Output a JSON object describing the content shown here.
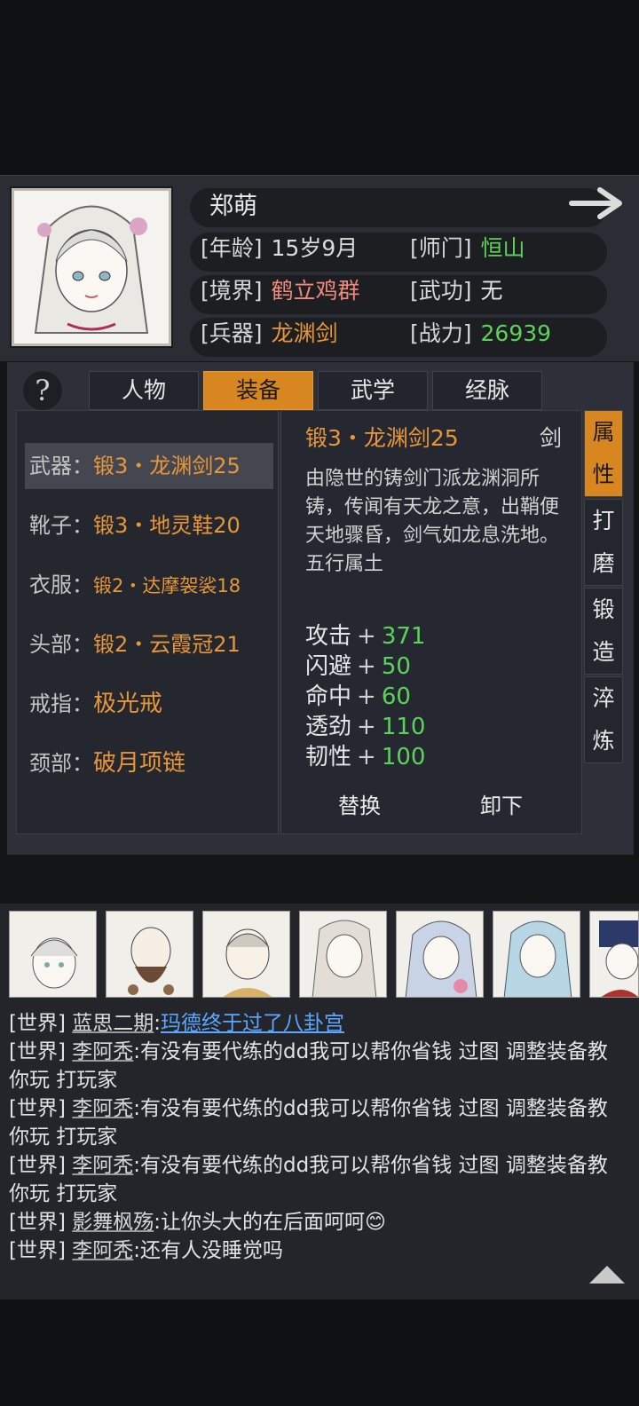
{
  "character": {
    "name": "郑萌",
    "stats": [
      {
        "key": "[年龄]",
        "value": "15岁9月",
        "color": "#dcdcdc"
      },
      {
        "key": "[师门]",
        "value": "恒山",
        "color": "#5bd35b"
      },
      {
        "key": "[境界]",
        "value": "鹤立鸡群",
        "color": "#f08a7a"
      },
      {
        "key": "[武功]",
        "value": "无",
        "color": "#e2e2e2"
      },
      {
        "key": "[兵器]",
        "value": "龙渊剑",
        "color": "#e8963a"
      },
      {
        "key": "[战力]",
        "value": "26939",
        "color": "#5bd35b"
      }
    ]
  },
  "tabs": [
    "人物",
    "装备",
    "武学",
    "经脉"
  ],
  "active_tab": "装备",
  "equipment_slots": [
    {
      "slot": "武器：",
      "item": "锻3・龙渊剑25"
    },
    {
      "slot": "靴子：",
      "item": "锻3・地灵鞋20"
    },
    {
      "slot": "衣服：",
      "item": "锻2・达摩袈裟18"
    },
    {
      "slot": "头部：",
      "item": "锻2・云霞冠21"
    },
    {
      "slot": "戒指：",
      "item": "极光戒"
    },
    {
      "slot": "颈部：",
      "item": "破月项链"
    }
  ],
  "detail": {
    "title": "锻3・龙渊剑25",
    "type": "剑",
    "description": "由隐世的铸剑门派龙渊洞所铸，传闻有天龙之意，出鞘便天地骤昏，剑气如龙息洗地。",
    "element": "五行属土",
    "attributes": [
      {
        "name": "攻击",
        "value": "371"
      },
      {
        "name": "闪避",
        "value": "50"
      },
      {
        "name": "命中",
        "value": "60"
      },
      {
        "name": "透劲",
        "value": "110"
      },
      {
        "name": "韧性",
        "value": "100"
      }
    ],
    "buttons": {
      "replace": "替换",
      "unequip": "卸下"
    }
  },
  "side_tabs": [
    {
      "label": "属性",
      "active": true
    },
    {
      "label": "打磨",
      "active": false
    },
    {
      "label": "锻造",
      "active": false
    },
    {
      "label": "淬炼",
      "active": false
    }
  ],
  "chat": [
    {
      "channel": "[世界]",
      "user": "蓝思二期",
      "text": ":",
      "link": "玛德终于过了八卦宫"
    },
    {
      "channel": "[世界]",
      "user": "李阿秃",
      "text": ":有没有要代练的dd我可以帮你省钱 过图 调整装备教你玩 打玩家"
    },
    {
      "channel": "[世界]",
      "user": "李阿秃",
      "text": ":有没有要代练的dd我可以帮你省钱 过图 调整装备教你玩 打玩家"
    },
    {
      "channel": "[世界]",
      "user": "李阿秃",
      "text": ":有没有要代练的dd我可以帮你省钱 过图 调整装备教你玩 打玩家"
    },
    {
      "channel": "[世界]",
      "user": "影舞枫殇",
      "text": ":让你头大的在后面呵呵😊"
    },
    {
      "channel": "[世界]",
      "user": "李阿秃",
      "text": ":还有人没睡觉吗"
    }
  ],
  "colors": {
    "accent": "#d8861f",
    "item_orange": "#e8963a",
    "green": "#5bd35b",
    "link_blue": "#5aa8ff"
  }
}
